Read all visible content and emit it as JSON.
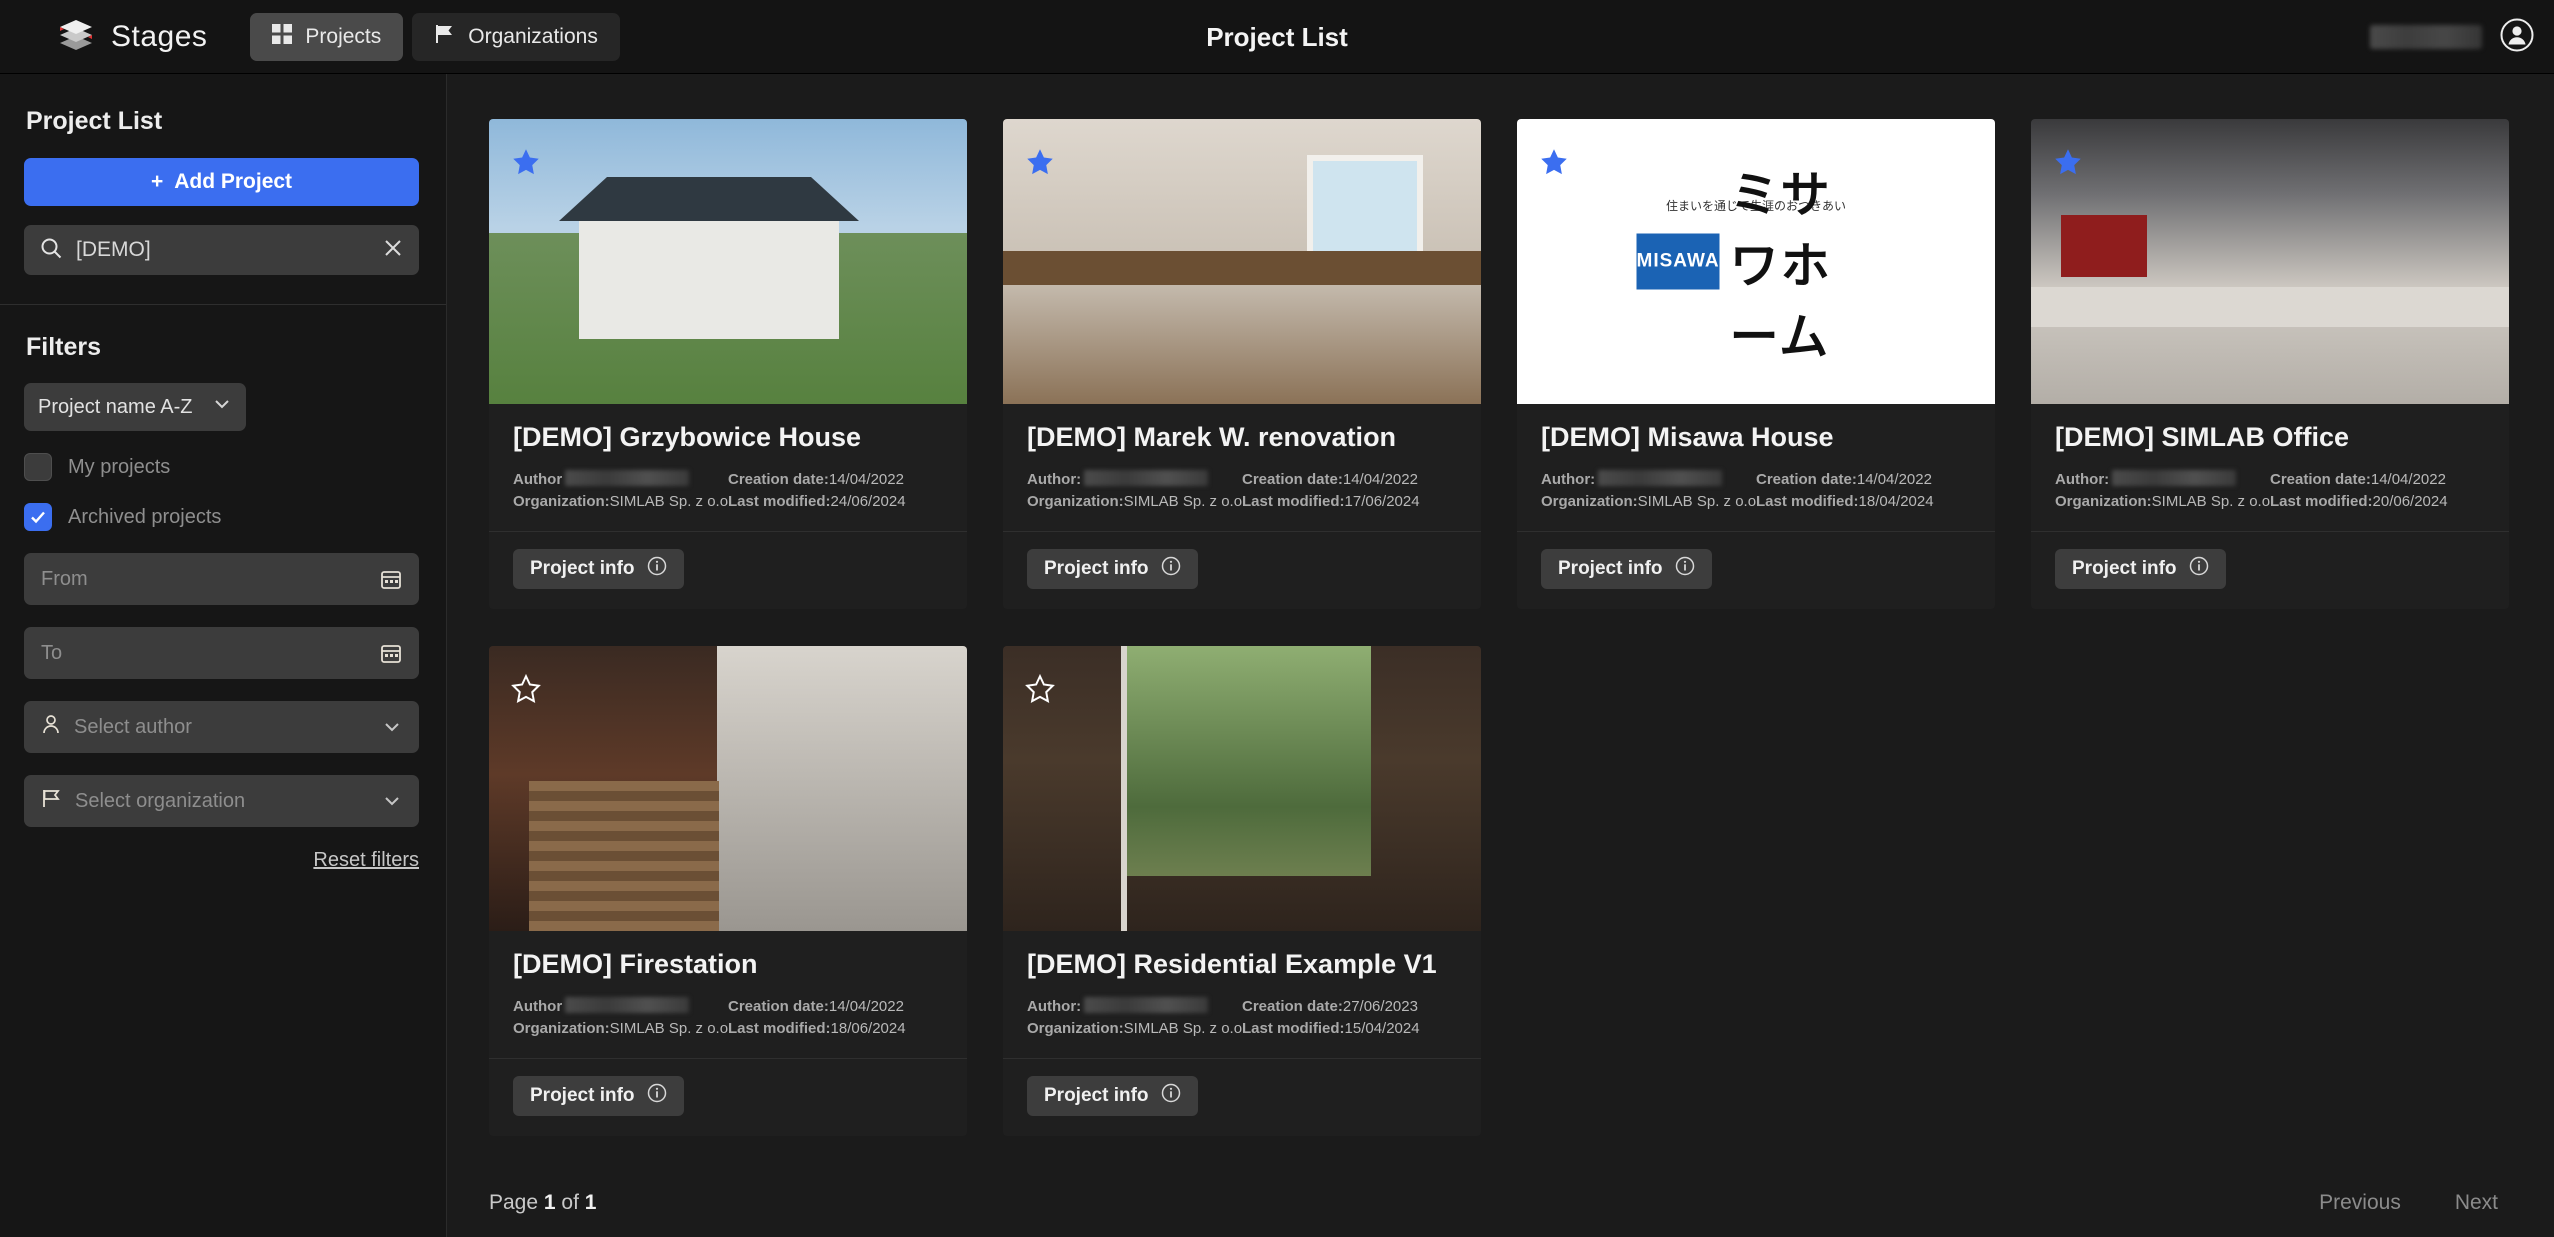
{
  "app": {
    "brand": "Stages",
    "page_title": "Project List",
    "nav": [
      {
        "label": "Projects",
        "icon": "grid-icon",
        "active": true
      },
      {
        "label": "Organizations",
        "icon": "flag-icon",
        "active": false
      }
    ],
    "account_icon": "user-circle-icon"
  },
  "sidebar": {
    "heading": "Project List",
    "add_project": "Add Project",
    "add_project_icon": "plus-icon",
    "search": {
      "icon": "search-icon",
      "value": "[DEMO]",
      "clear_icon": "close-icon"
    },
    "filters_heading": "Filters",
    "sort": {
      "value": "Project name A-Z",
      "icon": "chevron-down-icon"
    },
    "checkboxes": [
      {
        "label": "My projects",
        "checked": false
      },
      {
        "label": "Archived projects",
        "checked": true
      }
    ],
    "date_from": {
      "placeholder": "From",
      "value": "",
      "icon": "calendar-icon"
    },
    "date_to": {
      "placeholder": "To",
      "value": "",
      "icon": "calendar-icon"
    },
    "author_select": {
      "placeholder": "Select author",
      "icon": "user-icon",
      "chevron": "chevron-down-icon"
    },
    "organization_select": {
      "placeholder": "Select organization",
      "icon": "flag-icon",
      "chevron": "chevron-down-icon"
    },
    "reset_filters": "Reset filters"
  },
  "labels": {
    "author": "Author:",
    "author_nocolon": "Author",
    "organization": "Organization:",
    "creation_date": "Creation date:",
    "last_modified": "Last modified:",
    "project_info": "Project info",
    "info_icon": "info-circle-icon",
    "star_filled": "star-filled-icon",
    "star_outline": "star-outline-icon"
  },
  "projects": [
    {
      "title": "[DEMO] Grzybowice House",
      "author_label": "Author",
      "author": "",
      "organization": "SIMLAB Sp. z o.o.",
      "creation_date": "14/04/2022",
      "last_modified": "24/06/2024",
      "favorite": true,
      "thumb": "house-exterior",
      "action": "Project info"
    },
    {
      "title": "[DEMO] Marek W. renovation",
      "author_label": "Author:",
      "author": "",
      "organization": "SIMLAB Sp. z o.o.",
      "creation_date": "14/04/2022",
      "last_modified": "17/06/2024",
      "favorite": true,
      "thumb": "kitchen-interior",
      "action": "Project info"
    },
    {
      "title": "[DEMO] Misawa House",
      "author_label": "Author:",
      "author": "",
      "organization": "SIMLAB Sp. z o.o.",
      "creation_date": "14/04/2022",
      "last_modified": "18/04/2024",
      "favorite": true,
      "thumb": "misawa-logo",
      "action": "Project info"
    },
    {
      "title": "[DEMO] SIMLAB Office",
      "author_label": "Author:",
      "author": "",
      "organization": "SIMLAB Sp. z o.o.",
      "creation_date": "14/04/2022",
      "last_modified": "20/06/2024",
      "favorite": true,
      "thumb": "office-interior",
      "action": "Project info"
    },
    {
      "title": "[DEMO] Firestation",
      "author_label": "Author",
      "author": "",
      "organization": "SIMLAB Sp. z o.o.",
      "creation_date": "14/04/2022",
      "last_modified": "18/06/2024",
      "favorite": false,
      "thumb": "staircase-brick",
      "action": "Project info"
    },
    {
      "title": "[DEMO] Residential Example V1",
      "author_label": "Author:",
      "author": "",
      "organization": "SIMLAB Sp. z o.o.",
      "creation_date": "27/06/2023",
      "last_modified": "15/04/2024",
      "favorite": false,
      "thumb": "garden-view",
      "action": "Project info"
    }
  ],
  "misawa_logo": {
    "box_text": "MISAWA",
    "kana": "ミサワホーム",
    "tagline": "住まいを通じて生涯のおつきあい"
  },
  "pagination": {
    "page_prefix": "Page",
    "current": "1",
    "middle": "of",
    "total": "1",
    "previous": "Previous",
    "next": "Next"
  },
  "colors": {
    "accent": "#3b6ef0",
    "page_bg": "#1b1b1b",
    "panel_bg": "#161616",
    "card_bg": "#1f1f1f"
  }
}
